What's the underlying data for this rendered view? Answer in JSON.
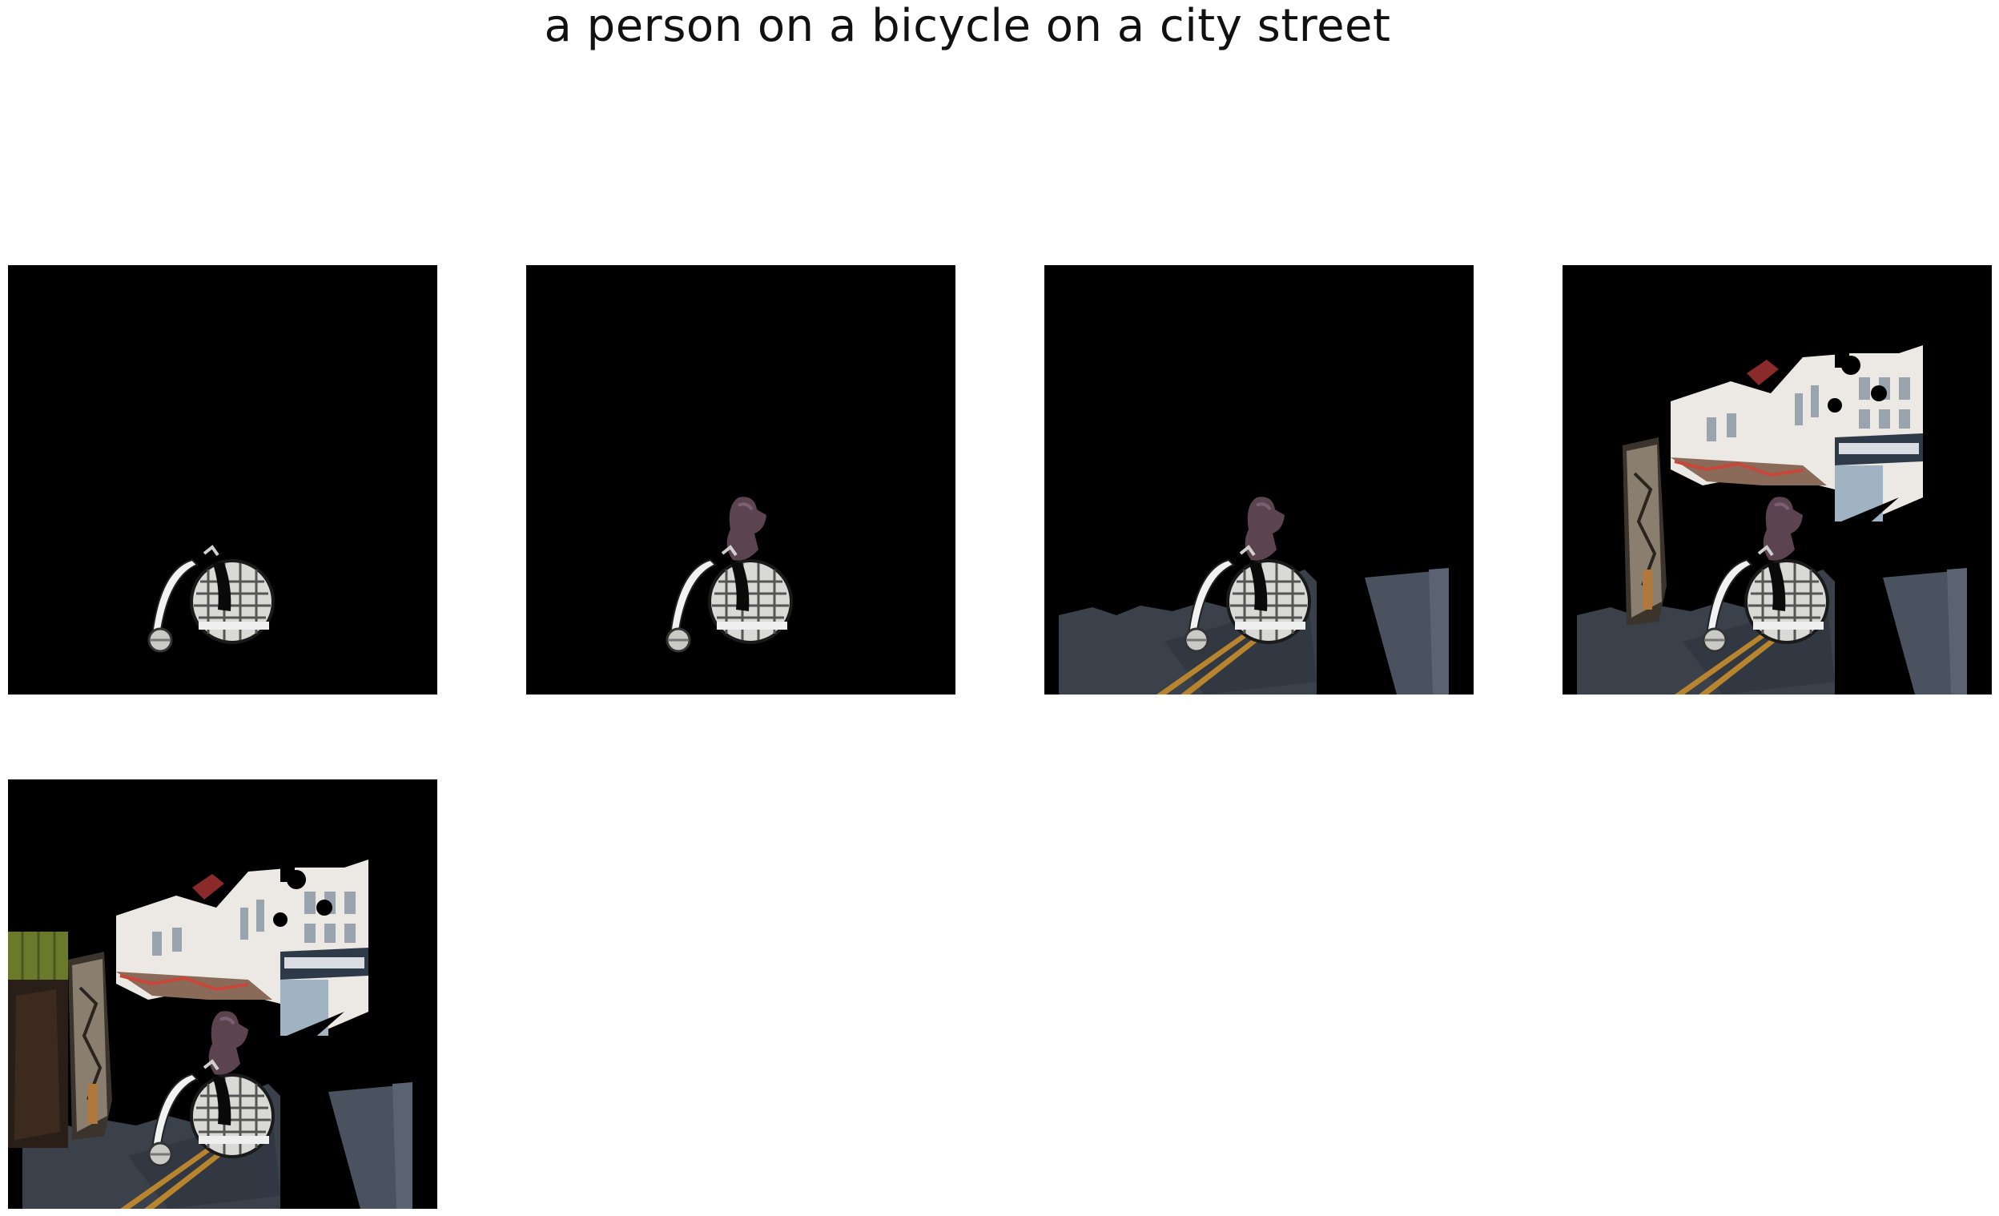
{
  "figure": {
    "title": "a person on a bicycle on a city street"
  },
  "panels": [
    {
      "step": 1,
      "segments": [
        "bicycle"
      ]
    },
    {
      "step": 2,
      "segments": [
        "bicycle",
        "person"
      ]
    },
    {
      "step": 3,
      "segments": [
        "bicycle",
        "person",
        "street"
      ]
    },
    {
      "step": 4,
      "segments": [
        "bicycle",
        "person",
        "street",
        "buildings"
      ]
    },
    {
      "step": 5,
      "segments": [
        "bicycle",
        "person",
        "street",
        "buildings",
        "storefront"
      ]
    }
  ],
  "colors": {
    "background": "#000000",
    "asphalt": "#3f4650",
    "road_line": "#b8842e",
    "building": "#e9e6e1",
    "person": "#5b4450",
    "awning": "#8a2a2a",
    "foliage": "#6a7a2a"
  }
}
